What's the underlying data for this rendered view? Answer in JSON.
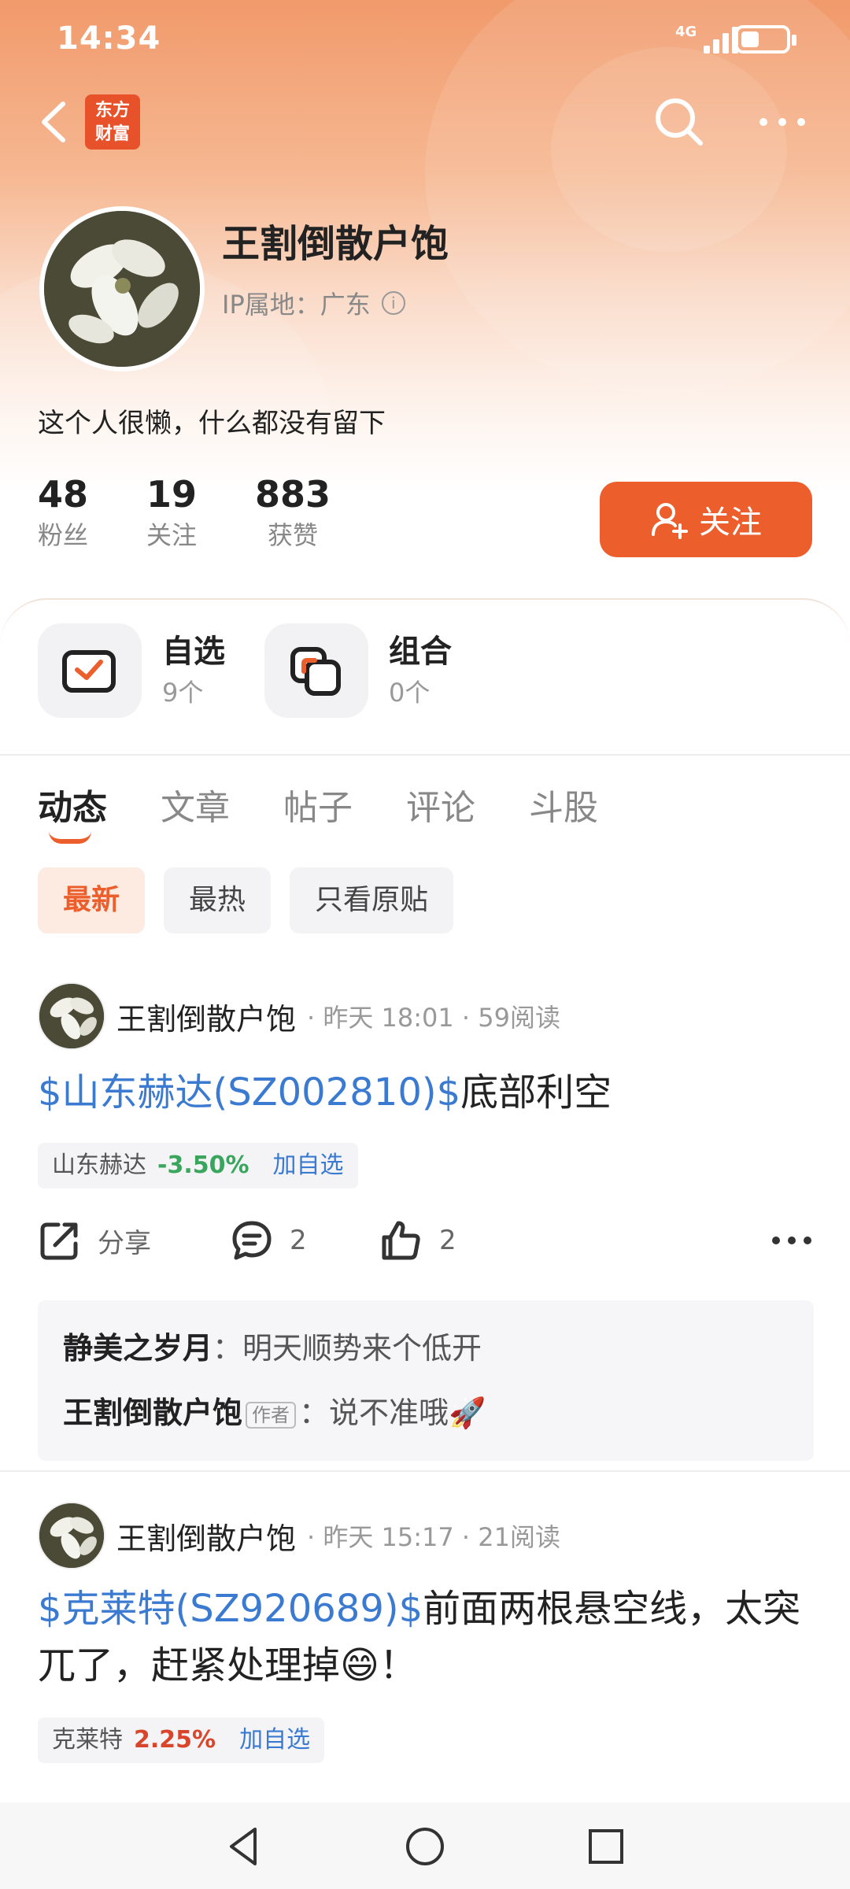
{
  "status_bar": {
    "time": "14:34",
    "network": "4G"
  },
  "header": {
    "logo_text": "东方财富"
  },
  "profile": {
    "name": "王割倒散户饱",
    "ip_location": "IP属地：广东",
    "bio": "这个人很懒，什么都没有留下",
    "stats": [
      {
        "value": "48",
        "label": "粉丝"
      },
      {
        "value": "19",
        "label": "关注"
      },
      {
        "value": "883",
        "label": "获赞"
      }
    ],
    "follow_label": "关注"
  },
  "quick_links": [
    {
      "title": "自选",
      "sub": "9个"
    },
    {
      "title": "组合",
      "sub": "0个"
    }
  ],
  "tabs": [
    "动态",
    "文章",
    "帖子",
    "评论",
    "斗股"
  ],
  "filters": [
    "最新",
    "最热",
    "只看原贴"
  ],
  "posts": [
    {
      "author": "王割倒散户饱",
      "meta": "· 昨天 18:01 · 59阅读",
      "tag": "$山东赫达(SZ002810)$",
      "text": "底部利空",
      "stock": {
        "name": "山东赫达",
        "pct": "-3.50%",
        "add": "加自选"
      },
      "share_label": "分享",
      "comment_count": "2",
      "like_count": "2",
      "comments": [
        {
          "user": "静美之岁月",
          "sep": "：",
          "text": "明天顺势来个低开"
        },
        {
          "user": "王割倒散户饱",
          "badge": "作者",
          "sep": "：",
          "text": "说不准哦🚀"
        }
      ]
    },
    {
      "author": "王割倒散户饱",
      "meta": "· 昨天 15:17 · 21阅读",
      "tag": "$克莱特(SZ920689)$",
      "text": "前面两根悬空线，太突兀了，赶紧处理掉😄！",
      "stock": {
        "name": "克莱特",
        "pct": "2.25%",
        "add": "加自选"
      }
    }
  ],
  "colors": {
    "accent": "#ec5f2c",
    "link": "#3b7ad1",
    "down": "#3aa55c",
    "up": "#d9452b"
  }
}
